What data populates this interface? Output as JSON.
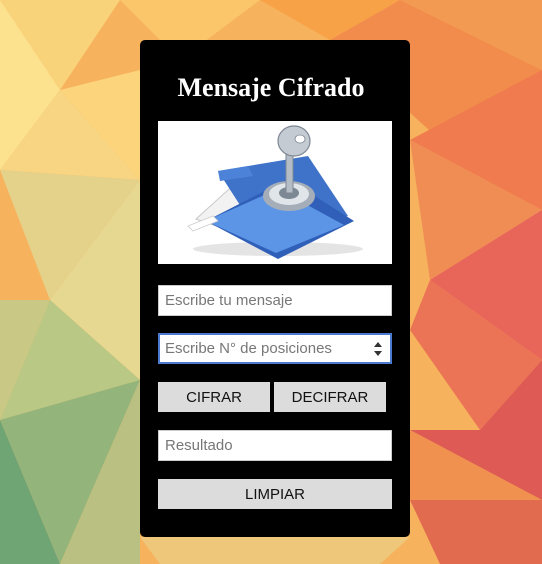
{
  "card": {
    "title": "Mensaje Cifrado"
  },
  "form": {
    "message_placeholder": "Escribe tu mensaje",
    "positions_placeholder": "Escribe N° de posiciones",
    "result_placeholder": "Resultado"
  },
  "buttons": {
    "encrypt_label": "CIFRAR",
    "decrypt_label": "DECIFRAR",
    "clear_label": "LIMPIAR"
  },
  "icons": {
    "image": "folder-key-image",
    "spinner": "number-spinner-icon"
  },
  "colors": {
    "card_bg": "#000000",
    "button_bg": "#dcdcdc",
    "focus_border": "#4a7bd0"
  }
}
